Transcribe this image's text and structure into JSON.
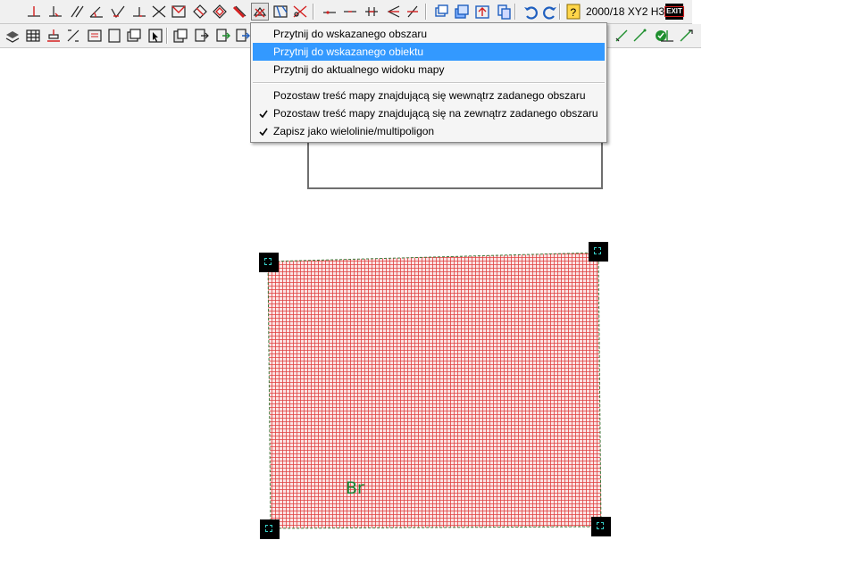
{
  "toolbar_top": {
    "layer_code": "2000/18 XY2 H3",
    "icons": [
      "perpendicular-icon",
      "perpendicular-foot-icon",
      "parallel-lines-icon",
      "angle-icon",
      "angle-check-icon",
      "perpendicular-line-icon",
      "intersection-icon",
      "envelope-icon",
      "diamond-icon",
      "diamond-outline-icon",
      "hatch-line-icon",
      "clip-scissors-icon",
      "clip-map-icon",
      "cut-icon",
      "point-on-line-icon",
      "line-icon",
      "double-perpendicular-icon",
      "arrow-left-icon",
      "slash-icon",
      "window-cascade-icon",
      "window-stack-icon",
      "upload-icon",
      "copy-icon",
      "undo-icon",
      "redo-icon",
      "help-icon",
      "exit-icon"
    ],
    "exit_label": "EXIT"
  },
  "toolbar_second": {
    "icons": [
      "layers-icon",
      "table-icon",
      "level-icon",
      "diagonal-icon",
      "text-box-icon",
      "page-icon",
      "windows-icon",
      "cursor-select-icon",
      "copy-print-icon",
      "export-icon",
      "green-arrow-icon",
      "blue-arrow-icon",
      "measure-icon",
      "vertex-icon",
      "ok-circle-icon",
      "perpendicular-measure-icon",
      "pin-icon"
    ]
  },
  "menu": {
    "items": [
      {
        "label": "Przytnij do wskazanego obszaru",
        "checked": false,
        "highlighted": false
      },
      {
        "label": "Przytnij do wskazanego obiektu",
        "checked": false,
        "highlighted": true
      },
      {
        "label": "Przytnij do aktualnego widoku mapy",
        "checked": false,
        "highlighted": false
      },
      {
        "label": "Pozostaw treść mapy znajdującą się wewnątrz zadanego obszaru",
        "checked": false,
        "highlighted": false
      },
      {
        "label": "Pozostaw treść mapy znajdującą się na zewnątrz zadanego obszaru",
        "checked": true,
        "highlighted": false
      },
      {
        "label": "Zapisz jako wielolinie/multipoligon",
        "checked": true,
        "highlighted": false
      }
    ]
  },
  "map": {
    "parcel_label": "Br",
    "colors": {
      "hatch": "#e04040",
      "fill": "#fbe4e4",
      "outline": "#3a7a3a",
      "label": "#138a38",
      "handle": "#000000",
      "highlight": "#3399ff"
    }
  }
}
